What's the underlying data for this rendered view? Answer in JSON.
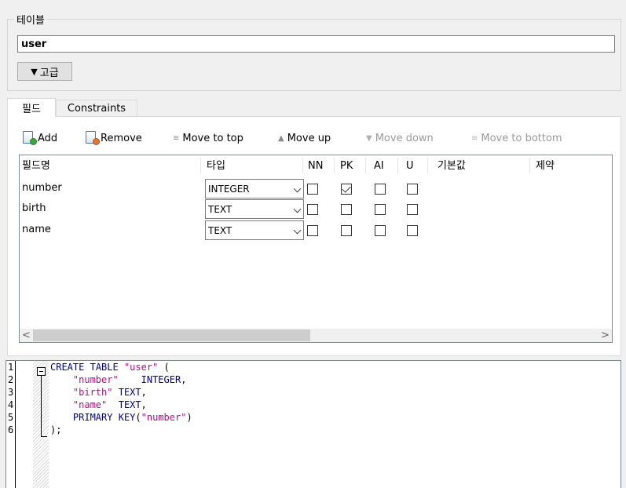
{
  "table_group": {
    "title": "테이블",
    "name_value": "user",
    "advanced_label": "고급",
    "advanced_arrow": "▼"
  },
  "tabs": [
    {
      "label": "필드",
      "active": true
    },
    {
      "label": "Constraints",
      "active": false
    }
  ],
  "toolbar": {
    "add": "Add",
    "remove": "Remove",
    "move_top": "Move to top",
    "move_up": "Move up",
    "move_down": "Move down",
    "move_bottom": "Move to bottom",
    "arrow_top": "≡",
    "arrow_up": "▲",
    "arrow_down": "▼",
    "arrow_bottom": "≡"
  },
  "grid": {
    "columns": [
      "필드명",
      "타입",
      "NN",
      "PK",
      "AI",
      "U",
      "기본값",
      "제약"
    ],
    "rows": [
      {
        "name": "number",
        "type": "INTEGER",
        "nn": false,
        "pk": true,
        "ai": false,
        "u": false
      },
      {
        "name": "birth",
        "type": "TEXT",
        "nn": false,
        "pk": false,
        "ai": false,
        "u": false
      },
      {
        "name": "name",
        "type": "TEXT",
        "nn": false,
        "pk": false,
        "ai": false,
        "u": false
      }
    ],
    "scroll_left": "<",
    "scroll_right": ">"
  },
  "sql": {
    "line_numbers": [
      "1",
      "2",
      "3",
      "4",
      "5",
      "6"
    ],
    "lines": [
      "CREATE TABLE \"user\" (",
      "    \"number\"    INTEGER,",
      "    \"birth\" TEXT,",
      "    \"name\"  TEXT,",
      "    PRIMARY KEY(\"number\")",
      ");"
    ]
  },
  "colors": {
    "accent_add": "#3aa83a",
    "accent_remove": "#e8752c",
    "sql_keyword": "#000080",
    "sql_string": "#b01080"
  }
}
